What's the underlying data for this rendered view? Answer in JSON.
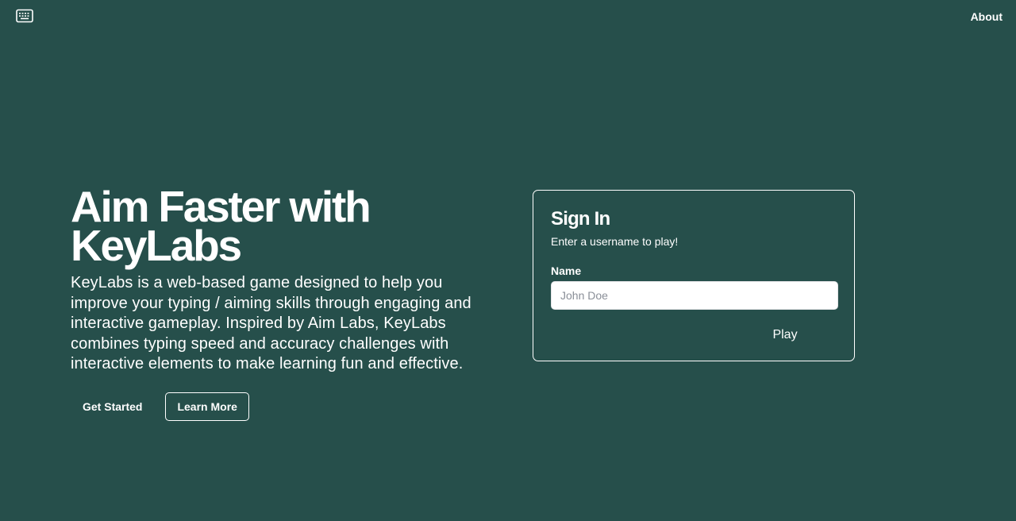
{
  "nav": {
    "logo_icon": "keyboard-icon",
    "about_label": "About"
  },
  "hero": {
    "title_line1": "Aim Faster with",
    "title_line2": "KeyLabs",
    "description": "KeyLabs is a web-based game designed to help you improve your typing / aiming skills through engaging and interactive gameplay. Inspired by Aim Labs, KeyLabs combines typing speed and accuracy challenges with interactive elements to make learning fun and effective.",
    "get_started_label": "Get Started",
    "learn_more_label": "Learn More"
  },
  "signin": {
    "title": "Sign In",
    "subtitle": "Enter a username to play!",
    "name_label": "Name",
    "name_placeholder": "John Doe",
    "name_value": "",
    "play_label": "Play"
  },
  "colors": {
    "background": "#264f4b",
    "text": "#ffffff",
    "input_background": "#ffffff"
  }
}
